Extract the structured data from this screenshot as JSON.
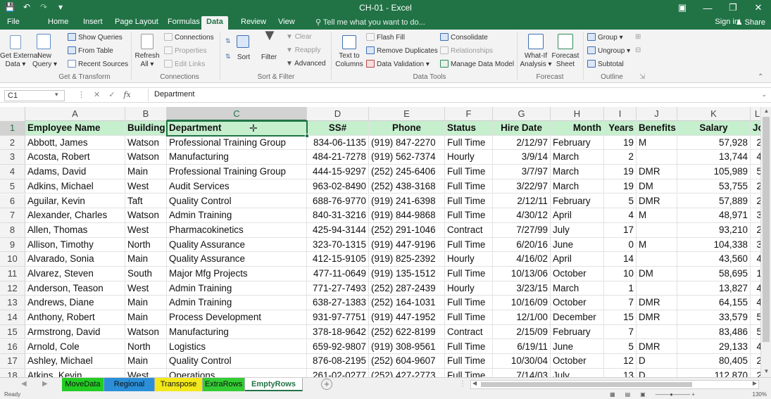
{
  "window": {
    "title": "CH-01 - Excel"
  },
  "tabs": [
    "File",
    "Home",
    "Insert",
    "Page Layout",
    "Formulas",
    "Data",
    "Review",
    "View"
  ],
  "active_tab": "Data",
  "tellme": "Tell me what you want to do...",
  "account": {
    "signin": "Sign in",
    "share": "Share"
  },
  "ribbon": {
    "get_transform": {
      "get_external": "Get External",
      "get_external2": "Data",
      "new_query": "New",
      "new_query2": "Query",
      "show_queries": "Show Queries",
      "from_table": "From Table",
      "recent_sources": "Recent Sources",
      "label": "Get & Transform"
    },
    "connections": {
      "refresh": "Refresh",
      "refresh2": "All",
      "connections": "Connections",
      "properties": "Properties",
      "edit_links": "Edit Links",
      "label": "Connections"
    },
    "sort_filter": {
      "sort": "Sort",
      "filter": "Filter",
      "clear": "Clear",
      "reapply": "Reapply",
      "advanced": "Advanced",
      "label": "Sort & Filter"
    },
    "data_tools": {
      "text_to": "Text to",
      "columns": "Columns",
      "flash_fill": "Flash Fill",
      "remove_duplicates": "Remove Duplicates",
      "data_validation": "Data Validation",
      "consolidate": "Consolidate",
      "relationships": "Relationships",
      "manage_model": "Manage Data Model",
      "label": "Data Tools"
    },
    "forecast": {
      "what_if": "What-If",
      "analysis": "Analysis",
      "forecast": "Forecast",
      "sheet": "Sheet",
      "label": "Forecast"
    },
    "outline": {
      "group": "Group",
      "ungroup": "Ungroup",
      "subtotal": "Subtotal",
      "label": "Outline"
    }
  },
  "formula_bar": {
    "name_box": "C1",
    "fx": "fx",
    "value": "Department"
  },
  "columns": [
    "A",
    "B",
    "C",
    "D",
    "E",
    "F",
    "G",
    "H",
    "I",
    "J",
    "K",
    "L"
  ],
  "row_numbers": [
    "1",
    "2",
    "3",
    "4",
    "5",
    "6",
    "7",
    "8",
    "9",
    "10",
    "11",
    "12",
    "13",
    "14",
    "15",
    "16",
    "17",
    "18"
  ],
  "headers": [
    "Employee Name",
    "Building",
    "Department",
    "SS#",
    "Phone",
    "Status",
    "Hire Date",
    "Month",
    "Years",
    "Benefits",
    "Salary",
    "Job Ra"
  ],
  "rows": [
    [
      "Abbott, James",
      "Watson",
      "Professional Training Group",
      "834-06-1135",
      "(919) 847-2270",
      "Full Time",
      "2/12/97",
      "February",
      "19",
      "M",
      "57,928",
      "2"
    ],
    [
      "Acosta, Robert",
      "Watson",
      "Manufacturing",
      "484-21-7278",
      "(919) 562-7374",
      "Hourly",
      "3/9/14",
      "March",
      "2",
      "",
      "13,744",
      "4"
    ],
    [
      "Adams, David",
      "Main",
      "Professional Training Group",
      "444-15-9297",
      "(252) 245-6406",
      "Full Time",
      "3/7/97",
      "March",
      "19",
      "DMR",
      "105,989",
      "5"
    ],
    [
      "Adkins, Michael",
      "West",
      "Audit Services",
      "963-02-8490",
      "(252) 438-3168",
      "Full Time",
      "3/22/97",
      "March",
      "19",
      "DM",
      "53,755",
      "2"
    ],
    [
      "Aguilar, Kevin",
      "Taft",
      "Quality Control",
      "688-76-9770",
      "(919) 241-6398",
      "Full Time",
      "2/12/11",
      "February",
      "5",
      "DMR",
      "57,889",
      "2"
    ],
    [
      "Alexander, Charles",
      "Watson",
      "Admin Training",
      "840-31-3216",
      "(919) 844-9868",
      "Full Time",
      "4/30/12",
      "April",
      "4",
      "M",
      "48,971",
      "3"
    ],
    [
      "Allen, Thomas",
      "West",
      "Pharmacokinetics",
      "425-94-3144",
      "(252) 291-1046",
      "Contract",
      "7/27/99",
      "July",
      "17",
      "",
      "93,210",
      "2"
    ],
    [
      "Allison, Timothy",
      "North",
      "Quality Assurance",
      "323-70-1315",
      "(919) 447-9196",
      "Full Time",
      "6/20/16",
      "June",
      "0",
      "M",
      "104,338",
      "3"
    ],
    [
      "Alvarado, Sonia",
      "Main",
      "Quality Assurance",
      "412-15-9105",
      "(919) 825-2392",
      "Hourly",
      "4/16/02",
      "April",
      "14",
      "",
      "43,560",
      "4"
    ],
    [
      "Alvarez, Steven",
      "South",
      "Major Mfg Projects",
      "477-11-0649",
      "(919) 135-1512",
      "Full Time",
      "10/13/06",
      "October",
      "10",
      "DM",
      "58,695",
      "1"
    ],
    [
      "Anderson, Teason",
      "West",
      "Admin Training",
      "771-27-7493",
      "(252) 287-2439",
      "Hourly",
      "3/23/15",
      "March",
      "1",
      "",
      "13,827",
      "4"
    ],
    [
      "Andrews, Diane",
      "Main",
      "Admin Training",
      "638-27-1383",
      "(252) 164-1031",
      "Full Time",
      "10/16/09",
      "October",
      "7",
      "DMR",
      "64,155",
      "4"
    ],
    [
      "Anthony, Robert",
      "Main",
      "Process Development",
      "931-97-7751",
      "(919) 447-1952",
      "Full Time",
      "12/1/00",
      "December",
      "15",
      "DMR",
      "33,579",
      "5"
    ],
    [
      "Armstrong, David",
      "Watson",
      "Manufacturing",
      "378-18-9642",
      "(252) 622-8199",
      "Contract",
      "2/15/09",
      "February",
      "7",
      "",
      "83,486",
      "5"
    ],
    [
      "Arnold, Cole",
      "North",
      "Logistics",
      "659-92-9807",
      "(919) 308-9561",
      "Full Time",
      "6/19/11",
      "June",
      "5",
      "DMR",
      "29,133",
      "4"
    ],
    [
      "Ashley, Michael",
      "Main",
      "Quality Control",
      "876-08-2195",
      "(252) 604-9607",
      "Full Time",
      "10/30/04",
      "October",
      "12",
      "D",
      "80,405",
      "2"
    ],
    [
      "Atkins, Kevin",
      "West",
      "Operations",
      "261-02-0277",
      "(252) 427-2773",
      "Full Time",
      "7/14/03",
      "July",
      "13",
      "D",
      "112,870",
      "2"
    ]
  ],
  "sheet_tabs": [
    {
      "label": "MoveData",
      "color": "#22cc22"
    },
    {
      "label": "Regional",
      "color": "#2a8fd8"
    },
    {
      "label": "Transpose",
      "color": "#f3e81a"
    },
    {
      "label": "ExtraRows",
      "color": "#33cc33"
    },
    {
      "label": "EmptyRows",
      "color": "#ffffff"
    }
  ],
  "status": {
    "ready": "Ready",
    "zoom": "130%"
  },
  "colors": {
    "excel_green": "#217346",
    "header_fill": "#c6efce"
  }
}
